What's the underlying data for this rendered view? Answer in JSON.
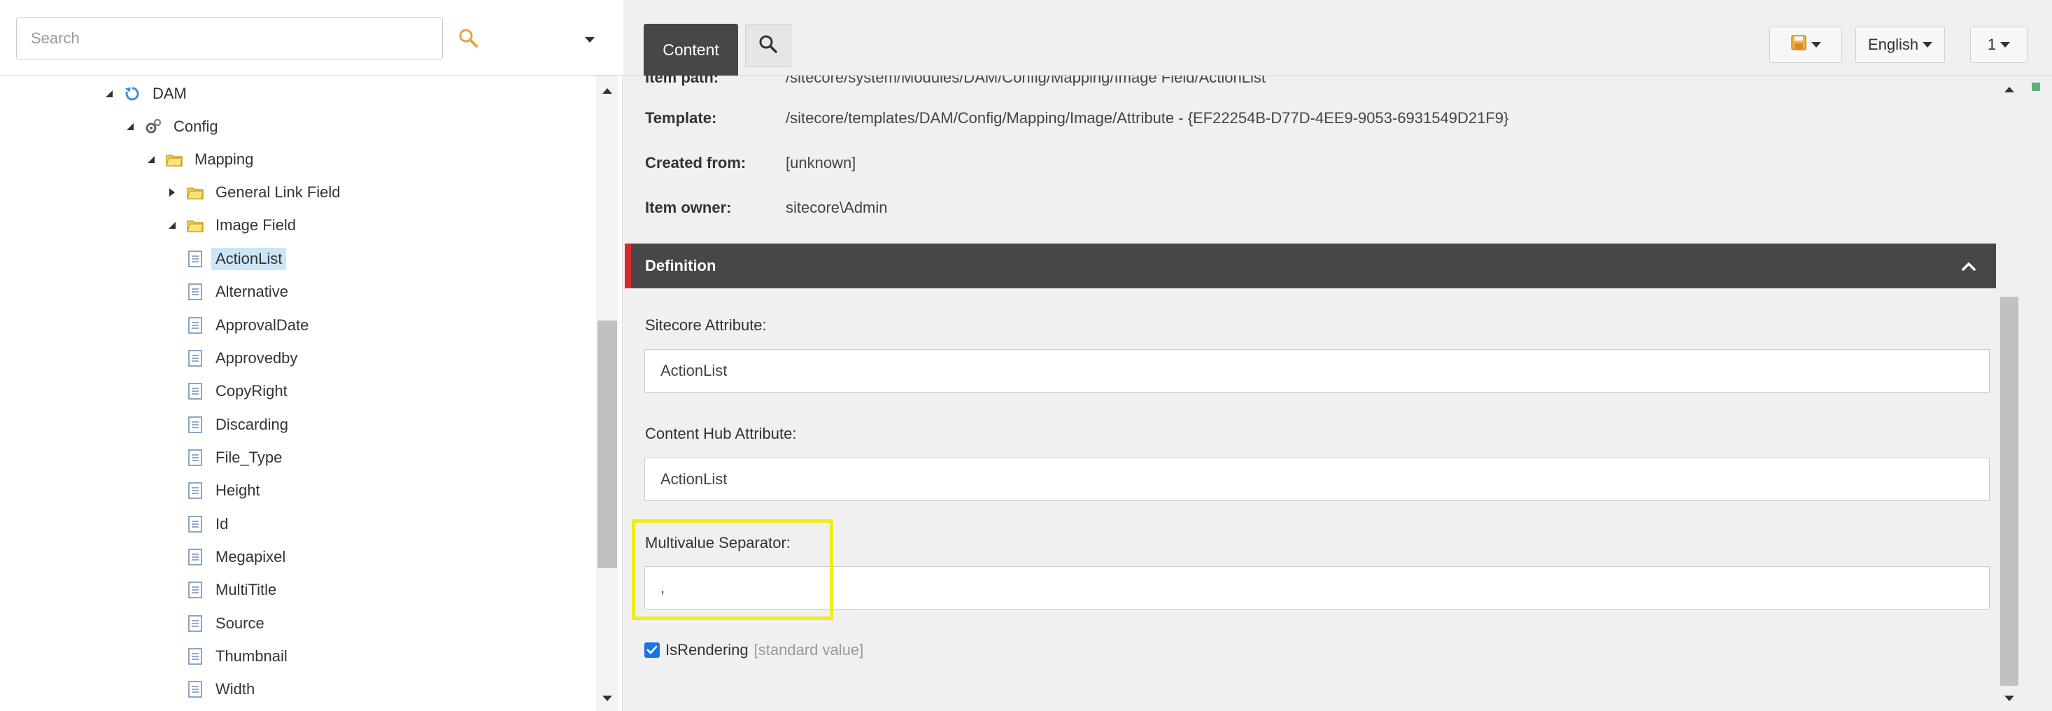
{
  "search": {
    "placeholder": "Search"
  },
  "tree": {
    "nodes": [
      {
        "label": "DAM"
      },
      {
        "label": "Config"
      },
      {
        "label": "Mapping"
      },
      {
        "label": "General Link Field"
      },
      {
        "label": "Image Field"
      },
      {
        "label": "ActionList"
      },
      {
        "label": "Alternative"
      },
      {
        "label": "ApprovalDate"
      },
      {
        "label": "Approvedby"
      },
      {
        "label": "CopyRight"
      },
      {
        "label": "Discarding"
      },
      {
        "label": "File_Type"
      },
      {
        "label": "Height"
      },
      {
        "label": "Id"
      },
      {
        "label": "Megapixel"
      },
      {
        "label": "MultiTitle"
      },
      {
        "label": "Source"
      },
      {
        "label": "Thumbnail"
      },
      {
        "label": "Width"
      }
    ]
  },
  "toolbar": {
    "content_tab": "Content",
    "language": "English",
    "version": "1"
  },
  "info": {
    "item_path_label": "Item path:",
    "item_path_value": "/sitecore/system/Modules/DAM/Config/Mapping/Image Field/ActionList",
    "template_label": "Template:",
    "template_value": "/sitecore/templates/DAM/Config/Mapping/Image/Attribute - {EF22254B-D77D-4EE9-9053-6931549D21F9}",
    "created_from_label": "Created from:",
    "created_from_value": "[unknown]",
    "item_owner_label": "Item owner:",
    "item_owner_value": "sitecore\\Admin"
  },
  "definition": {
    "title": "Definition",
    "sitecore_attribute_label": "Sitecore Attribute:",
    "sitecore_attribute_value": "ActionList",
    "content_hub_attribute_label": "Content Hub Attribute:",
    "content_hub_attribute_value": "ActionList",
    "multivalue_separator_label": "Multivalue Separator:",
    "multivalue_separator_value": ",",
    "isrendering_label": "IsRendering",
    "isrendering_standard": "[standard value]",
    "isrendering_checked": true
  },
  "colors": {
    "tab_active_bg": "#474747",
    "section_accent": "#d52b2b",
    "highlight": "#f2ec18",
    "selected_item_bg": "#cde6f7",
    "checkbox": "#1a73e8"
  }
}
